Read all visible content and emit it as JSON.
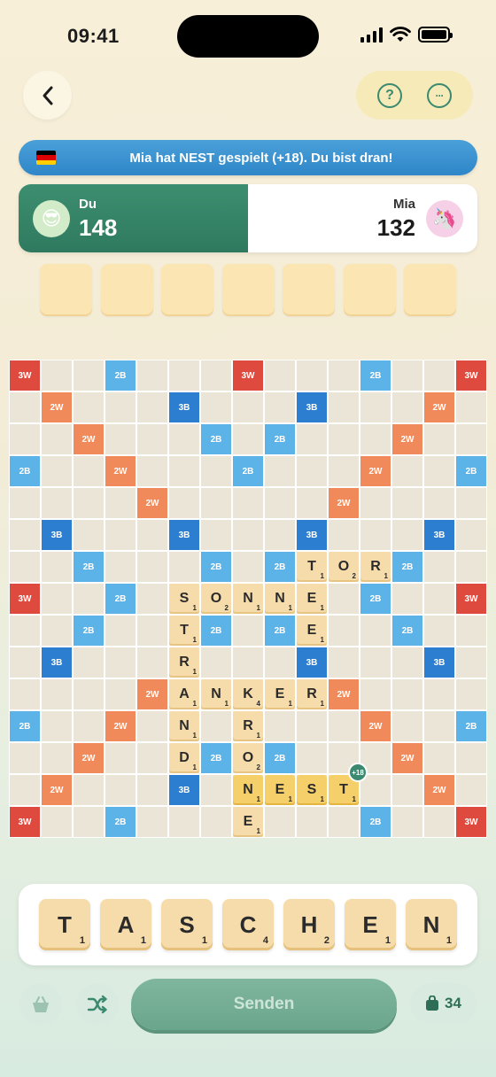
{
  "status": {
    "time": "09:41"
  },
  "header": {
    "help_icon": "?",
    "more_icon": "···"
  },
  "banner": {
    "text": "Mia hat NEST gespielt (+18). Du bist dran!",
    "flag_colors": [
      "#000000",
      "#dd0000",
      "#ffce00"
    ]
  },
  "players": {
    "me": {
      "name": "Du",
      "score": "148",
      "avatar": "😎"
    },
    "opponent": {
      "name": "Mia",
      "score": "132",
      "avatar": "🦄"
    }
  },
  "empty_slots": 7,
  "board": {
    "premiums": [
      [
        "3W",
        "",
        "",
        "2B",
        "",
        "",
        "",
        "3W",
        "",
        "",
        "",
        "2B",
        "",
        "",
        "3W"
      ],
      [
        "",
        "2W",
        "",
        "",
        "",
        "3B",
        "",
        "",
        "",
        "3B",
        "",
        "",
        "",
        "2W",
        ""
      ],
      [
        "",
        "",
        "2W",
        "",
        "",
        "",
        "2B",
        "",
        "2B",
        "",
        "",
        "",
        "2W",
        "",
        ""
      ],
      [
        "2B",
        "",
        "",
        "2W",
        "",
        "",
        "",
        "2B",
        "",
        "",
        "",
        "2W",
        "",
        "",
        "2B"
      ],
      [
        "",
        "",
        "",
        "",
        "2W",
        "",
        "",
        "",
        "",
        "",
        "2W",
        "",
        "",
        "",
        ""
      ],
      [
        "",
        "3B",
        "",
        "",
        "",
        "3B",
        "",
        "",
        "",
        "3B",
        "",
        "",
        "",
        "3B",
        ""
      ],
      [
        "",
        "",
        "2B",
        "",
        "",
        "",
        "2B",
        "",
        "2B",
        "",
        "",
        "",
        "2B",
        "",
        ""
      ],
      [
        "3W",
        "",
        "",
        "2B",
        "",
        "",
        "",
        "",
        "",
        "",
        "",
        "2B",
        "",
        "",
        "3W"
      ],
      [
        "",
        "",
        "2B",
        "",
        "",
        "",
        "2B",
        "",
        "2B",
        "",
        "",
        "",
        "2B",
        "",
        ""
      ],
      [
        "",
        "3B",
        "",
        "",
        "",
        "",
        "",
        "",
        "",
        "3B",
        "",
        "",
        "",
        "3B",
        ""
      ],
      [
        "",
        "",
        "",
        "",
        "2W",
        "",
        "",
        "",
        "",
        "",
        "2W",
        "",
        "",
        "",
        ""
      ],
      [
        "2B",
        "",
        "",
        "2W",
        "",
        "",
        "",
        "",
        "",
        "",
        "",
        "2W",
        "",
        "",
        "2B"
      ],
      [
        "",
        "",
        "2W",
        "",
        "",
        "",
        "2B",
        "",
        "2B",
        "",
        "",
        "",
        "2W",
        "",
        ""
      ],
      [
        "",
        "2W",
        "",
        "",
        "",
        "3B",
        "",
        "",
        "",
        "",
        "",
        "",
        "",
        "2W",
        ""
      ],
      [
        "3W",
        "",
        "",
        "2B",
        "",
        "",
        "",
        "",
        "",
        "",
        "",
        "2B",
        "",
        "",
        "3W"
      ]
    ],
    "tiles": [
      {
        "r": 6,
        "c": 9,
        "l": "T",
        "p": "1"
      },
      {
        "r": 6,
        "c": 10,
        "l": "O",
        "p": "2"
      },
      {
        "r": 6,
        "c": 11,
        "l": "R",
        "p": "1"
      },
      {
        "r": 7,
        "c": 5,
        "l": "S",
        "p": "1"
      },
      {
        "r": 7,
        "c": 6,
        "l": "O",
        "p": "2"
      },
      {
        "r": 7,
        "c": 7,
        "l": "N",
        "p": "1"
      },
      {
        "r": 7,
        "c": 8,
        "l": "N",
        "p": "1"
      },
      {
        "r": 7,
        "c": 9,
        "l": "E",
        "p": "1"
      },
      {
        "r": 8,
        "c": 5,
        "l": "T",
        "p": "1"
      },
      {
        "r": 8,
        "c": 9,
        "l": "E",
        "p": "1"
      },
      {
        "r": 9,
        "c": 5,
        "l": "R",
        "p": "1"
      },
      {
        "r": 10,
        "c": 5,
        "l": "A",
        "p": "1"
      },
      {
        "r": 10,
        "c": 6,
        "l": "N",
        "p": "1"
      },
      {
        "r": 10,
        "c": 7,
        "l": "K",
        "p": "4"
      },
      {
        "r": 10,
        "c": 8,
        "l": "E",
        "p": "1"
      },
      {
        "r": 10,
        "c": 9,
        "l": "R",
        "p": "1"
      },
      {
        "r": 11,
        "c": 5,
        "l": "N",
        "p": "1"
      },
      {
        "r": 11,
        "c": 7,
        "l": "R",
        "p": "1"
      },
      {
        "r": 12,
        "c": 5,
        "l": "D",
        "p": "1"
      },
      {
        "r": 12,
        "c": 7,
        "l": "O",
        "p": "2"
      },
      {
        "r": 13,
        "c": 7,
        "l": "N",
        "p": "1",
        "new": true
      },
      {
        "r": 13,
        "c": 8,
        "l": "E",
        "p": "1",
        "new": true
      },
      {
        "r": 13,
        "c": 9,
        "l": "S",
        "p": "1",
        "new": true
      },
      {
        "r": 13,
        "c": 10,
        "l": "T",
        "p": "1",
        "new": true,
        "badge": "+18"
      },
      {
        "r": 14,
        "c": 7,
        "l": "E",
        "p": "1"
      }
    ]
  },
  "rack": [
    {
      "l": "T",
      "p": "1"
    },
    {
      "l": "A",
      "p": "1"
    },
    {
      "l": "S",
      "p": "1"
    },
    {
      "l": "C",
      "p": "4"
    },
    {
      "l": "H",
      "p": "2"
    },
    {
      "l": "E",
      "p": "1"
    },
    {
      "l": "N",
      "p": "1"
    }
  ],
  "controls": {
    "send_label": "Senden",
    "bag_count": "34"
  }
}
